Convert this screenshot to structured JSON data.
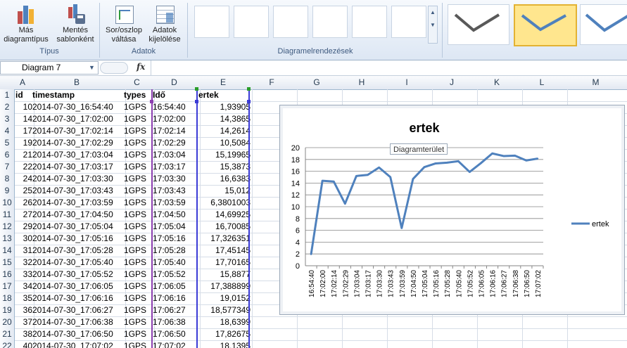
{
  "ribbon": {
    "groups": [
      {
        "label": "Típus",
        "buttons": [
          "Más\ndiagramtípus",
          "Mentés\nsablonként"
        ]
      },
      {
        "label": "Adatok",
        "buttons": [
          "Sor/oszlop\nváltása",
          "Adatok\nkijelölése"
        ]
      },
      {
        "label": "Diagramelrendezések"
      }
    ]
  },
  "formula_bar": {
    "name_box": "Diagram 7",
    "fx": "fx"
  },
  "columns": [
    "A",
    "B",
    "C",
    "D",
    "E",
    "F",
    "G",
    "H",
    "I",
    "J",
    "K",
    "L",
    "M"
  ],
  "headers": [
    "id",
    "timestamp",
    "types",
    "Idő",
    "ertek"
  ],
  "rows": [
    [
      "10",
      "2014-07-30_16:54:40",
      "1GPS",
      "16:54:40",
      "1,93905"
    ],
    [
      "14",
      "2014-07-30_17:02:00",
      "1GPS",
      "17:02:00",
      "14,3865"
    ],
    [
      "17",
      "2014-07-30_17:02:14",
      "1GPS",
      "17:02:14",
      "14,2614"
    ],
    [
      "19",
      "2014-07-30_17:02:29",
      "1GPS",
      "17:02:29",
      "10,5084"
    ],
    [
      "21",
      "2014-07-30_17:03:04",
      "1GPS",
      "17:03:04",
      "15,19965"
    ],
    [
      "22",
      "2014-07-30_17:03:17",
      "1GPS",
      "17:03:17",
      "15,3873"
    ],
    [
      "24",
      "2014-07-30_17:03:30",
      "1GPS",
      "17:03:30",
      "16,6383"
    ],
    [
      "25",
      "2014-07-30_17:03:43",
      "1GPS",
      "17:03:43",
      "15,012"
    ],
    [
      "26",
      "2014-07-30_17:03:59",
      "1GPS",
      "17:03:59",
      "6,3801003"
    ],
    [
      "27",
      "2014-07-30_17:04:50",
      "1GPS",
      "17:04:50",
      "14,69925"
    ],
    [
      "29",
      "2014-07-30_17:05:04",
      "1GPS",
      "17:05:04",
      "16,70085"
    ],
    [
      "30",
      "2014-07-30_17:05:16",
      "1GPS",
      "17:05:16",
      "17,326351"
    ],
    [
      "31",
      "2014-07-30_17:05:28",
      "1GPS",
      "17:05:28",
      "17,45145"
    ],
    [
      "32",
      "2014-07-30_17:05:40",
      "1GPS",
      "17:05:40",
      "17,70165"
    ],
    [
      "33",
      "2014-07-30_17:05:52",
      "1GPS",
      "17:05:52",
      "15,8877"
    ],
    [
      "34",
      "2014-07-30_17:06:05",
      "1GPS",
      "17:06:05",
      "17,388899"
    ],
    [
      "35",
      "2014-07-30_17:06:16",
      "1GPS",
      "17:06:16",
      "19,0152"
    ],
    [
      "36",
      "2014-07-30_17:06:27",
      "1GPS",
      "17:06:27",
      "18,577349"
    ],
    [
      "37",
      "2014-07-30_17:06:38",
      "1GPS",
      "17:06:38",
      "18,6399"
    ],
    [
      "38",
      "2014-07-30_17:06:50",
      "1GPS",
      "17:06:50",
      "17,82675"
    ],
    [
      "40",
      "2014-07-30_17:07:02",
      "1GPS",
      "17:07:02",
      "18,1395"
    ]
  ],
  "chart_tooltip": "Diagramterület",
  "chart_data": {
    "type": "line",
    "title": "ertek",
    "categories": [
      "16:54:40",
      "17:02:00",
      "17:02:14",
      "17:02:29",
      "17:03:04",
      "17:03:17",
      "17:03:30",
      "17:03:43",
      "17:03:59",
      "17:04:50",
      "17:05:04",
      "17:05:16",
      "17:05:28",
      "17:05:40",
      "17:05:52",
      "17:06:05",
      "17:06:16",
      "17:06:27",
      "17:06:38",
      "17:06:50",
      "17:07:02"
    ],
    "series": [
      {
        "name": "ertek",
        "values": [
          1.93905,
          14.3865,
          14.2614,
          10.5084,
          15.19965,
          15.3873,
          16.6383,
          15.012,
          6.3801003,
          14.69925,
          16.70085,
          17.326351,
          17.45145,
          17.70165,
          15.8877,
          17.388899,
          19.0152,
          18.577349,
          18.6399,
          17.82675,
          18.1395
        ],
        "color": "#4f81bd"
      }
    ],
    "ylim": [
      0,
      20
    ],
    "yticks": [
      "0",
      "2",
      "4",
      "6",
      "8",
      "10",
      "12",
      "14",
      "16",
      "18",
      "20"
    ],
    "grid": true,
    "legend": "right"
  }
}
